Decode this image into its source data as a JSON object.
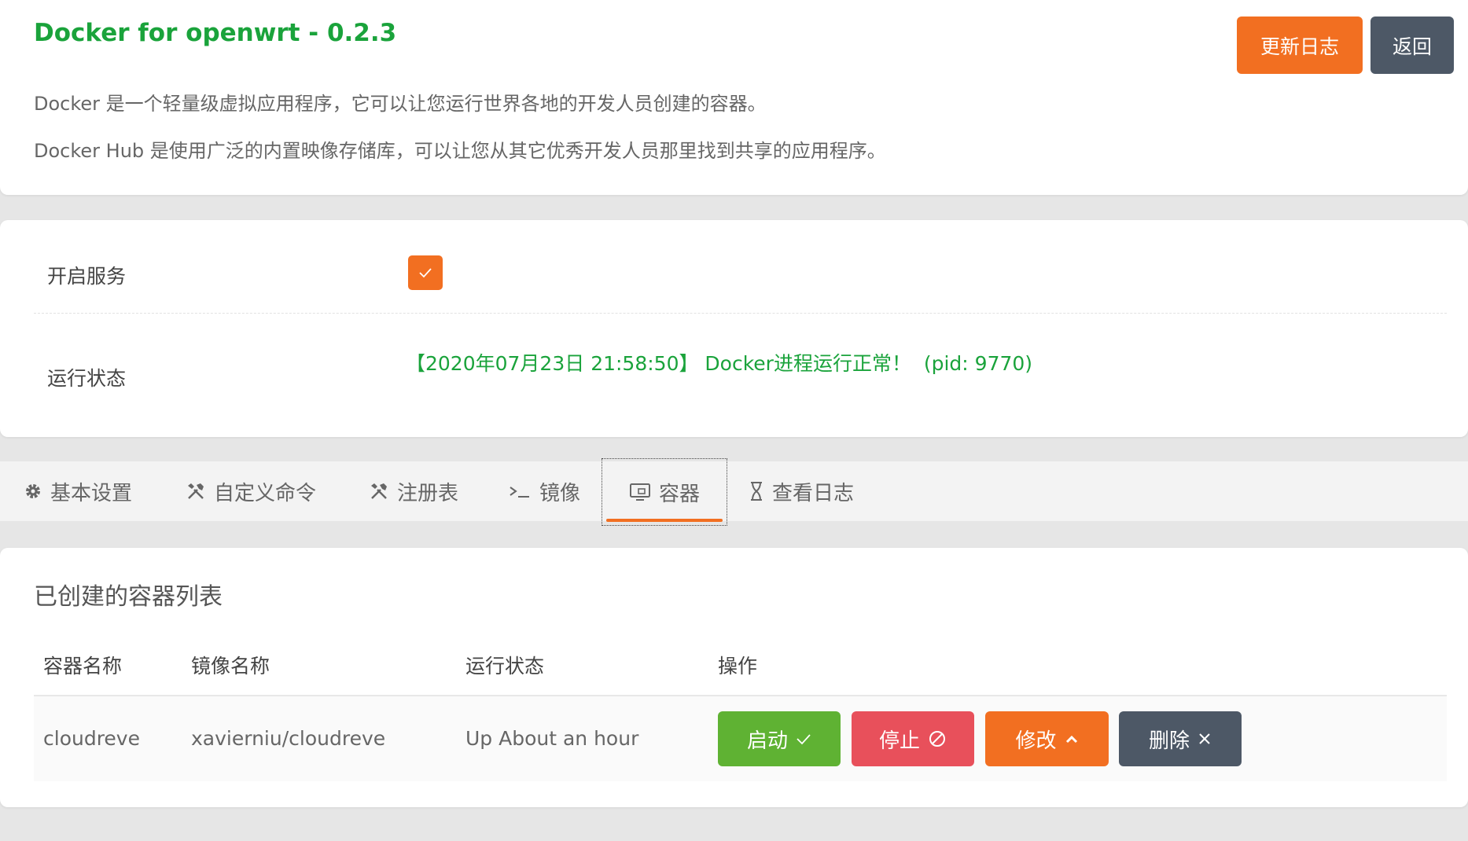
{
  "header": {
    "title": "Docker for openwrt - 0.2.3",
    "desc1": "Docker 是一个轻量级虚拟应用程序，它可以让您运行世界各地的开发人员创建的容器。",
    "desc2": "Docker Hub 是使用广泛的内置映像存储库，可以让您从其它优秀开发人员那里找到共享的应用程序。",
    "changelog_label": "更新日志",
    "back_label": "返回"
  },
  "service": {
    "enable_label": "开启服务",
    "enabled": true,
    "status_label": "运行状态",
    "status_text": "【2020年07月23日 21:58:50】 Docker进程运行正常！  (pid: 9770)"
  },
  "tabs": [
    {
      "label": "基本设置",
      "icon": "gear-icon"
    },
    {
      "label": "自定义命令",
      "icon": "tools-icon"
    },
    {
      "label": "注册表",
      "icon": "tools-icon"
    },
    {
      "label": "镜像",
      "icon": "terminal-icon"
    },
    {
      "label": "容器",
      "icon": "monitor-icon",
      "active": true
    },
    {
      "label": "查看日志",
      "icon": "hourglass-icon"
    }
  ],
  "containers": {
    "title": "已创建的容器列表",
    "columns": [
      "容器名称",
      "镜像名称",
      "运行状态",
      "操作"
    ],
    "rows": [
      {
        "name": "cloudreve",
        "image": "xavierniu/cloudreve",
        "status": "Up About an hour"
      }
    ],
    "actions": {
      "start": "启动",
      "stop": "停止",
      "edit": "修改",
      "delete": "删除"
    }
  },
  "colors": {
    "accent": "#f26f21",
    "title_green": "#1aa33b",
    "dark_button": "#4d5866",
    "start_green": "#5fb233",
    "stop_red": "#e8505b"
  }
}
